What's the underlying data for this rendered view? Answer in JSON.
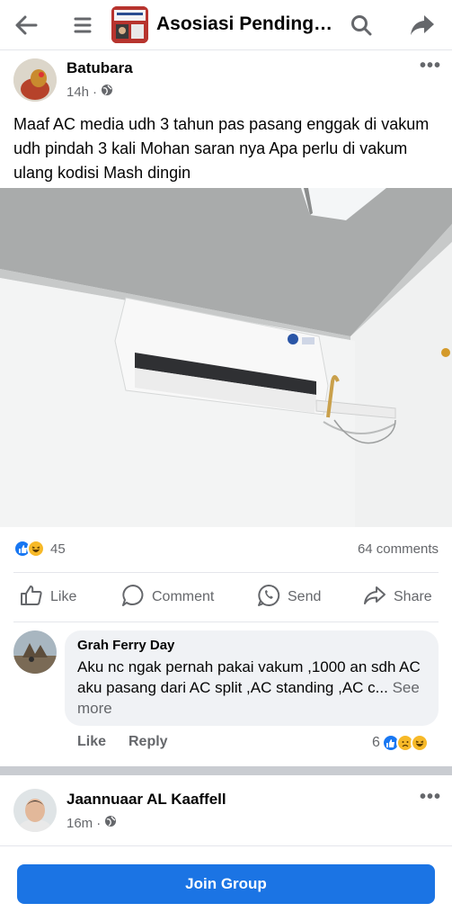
{
  "header": {
    "group_name": "Asosiasi Pendingin...",
    "icons": [
      "back-arrow-icon",
      "menu-icon",
      "search-icon",
      "share-arrow-icon"
    ]
  },
  "post": {
    "author": "Batubara",
    "time": "14h",
    "privacy_icon": "globe-icon",
    "text": "Maaf AC media udh 3 tahun pas pasang enggak di vakum udh pindah 3 kali Mohan saran nya Apa perlu di vakum ulang kodisi Mash dingin",
    "image_description_icon": "air-conditioner-photo",
    "reactions": {
      "count": "45",
      "types": [
        "like",
        "haha"
      ]
    },
    "comments_count": "64 comments",
    "actions": {
      "like": "Like",
      "comment": "Comment",
      "send": "Send",
      "share": "Share"
    }
  },
  "comment": {
    "author": "Grah Ferry Day",
    "text": "Aku nc ngak pernah pakai vakum ,1000 an sdh AC aku pasang dari AC split ,AC standing ,AC c...",
    "see_more": "See more",
    "like": "Like",
    "reply": "Reply",
    "reaction_count": "6",
    "reaction_types": [
      "like",
      "sad",
      "haha"
    ]
  },
  "next_post": {
    "author": "Jaannuaar AL Kaaffell",
    "time": "16m"
  },
  "footer": {
    "join_label": "Join Group"
  },
  "colors": {
    "accent": "#1b74e4",
    "like_blue": "#1877f2",
    "haha_yellow": "#f7b928",
    "secondary_text": "#65676b"
  }
}
